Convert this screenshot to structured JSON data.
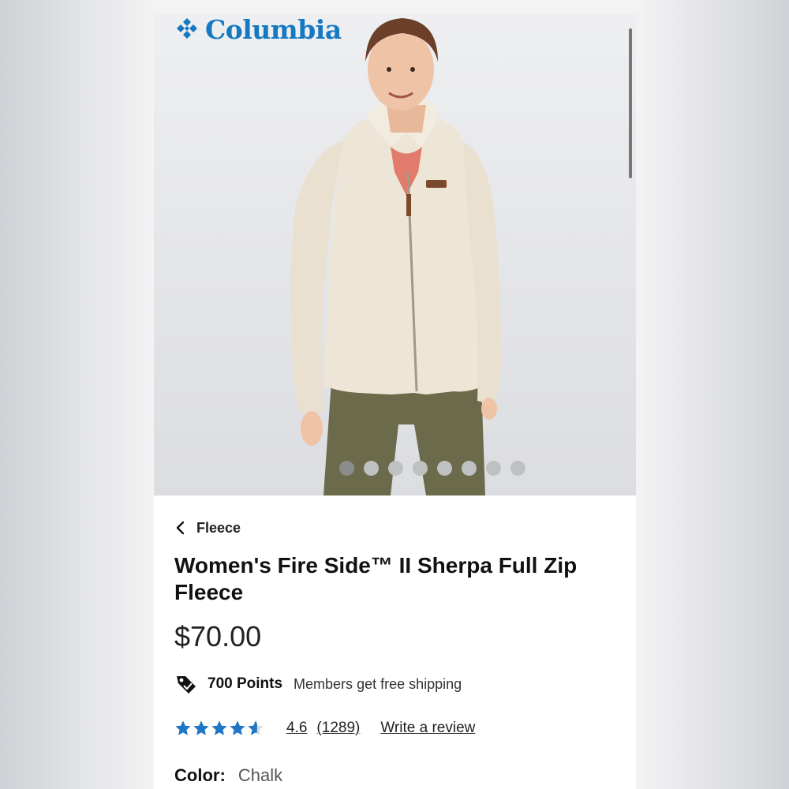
{
  "brand": {
    "name": "Columbia",
    "color": "#1578c2",
    "logo_icon": "columbia-diamond-logo-icon"
  },
  "gallery": {
    "image_alt": "Woman wearing cream sherpa full zip fleece jacket",
    "total_images": 8,
    "active_index": 1
  },
  "breadcrumb": {
    "icon": "chevron-left-icon",
    "label": "Fleece"
  },
  "product": {
    "title": "Women's Fire Side™ II Sherpa Full Zip Fleece",
    "price": "$70.00"
  },
  "rewards": {
    "icon": "price-tag-icon",
    "points": "700 Points",
    "shipping": "Members get free shipping"
  },
  "reviews": {
    "stars": 4.6,
    "star_color": "#1f76c2",
    "rating": "4.6",
    "count": "(1289)",
    "write_label": "Write a review"
  },
  "color": {
    "label": "Color:",
    "value": "Chalk"
  }
}
